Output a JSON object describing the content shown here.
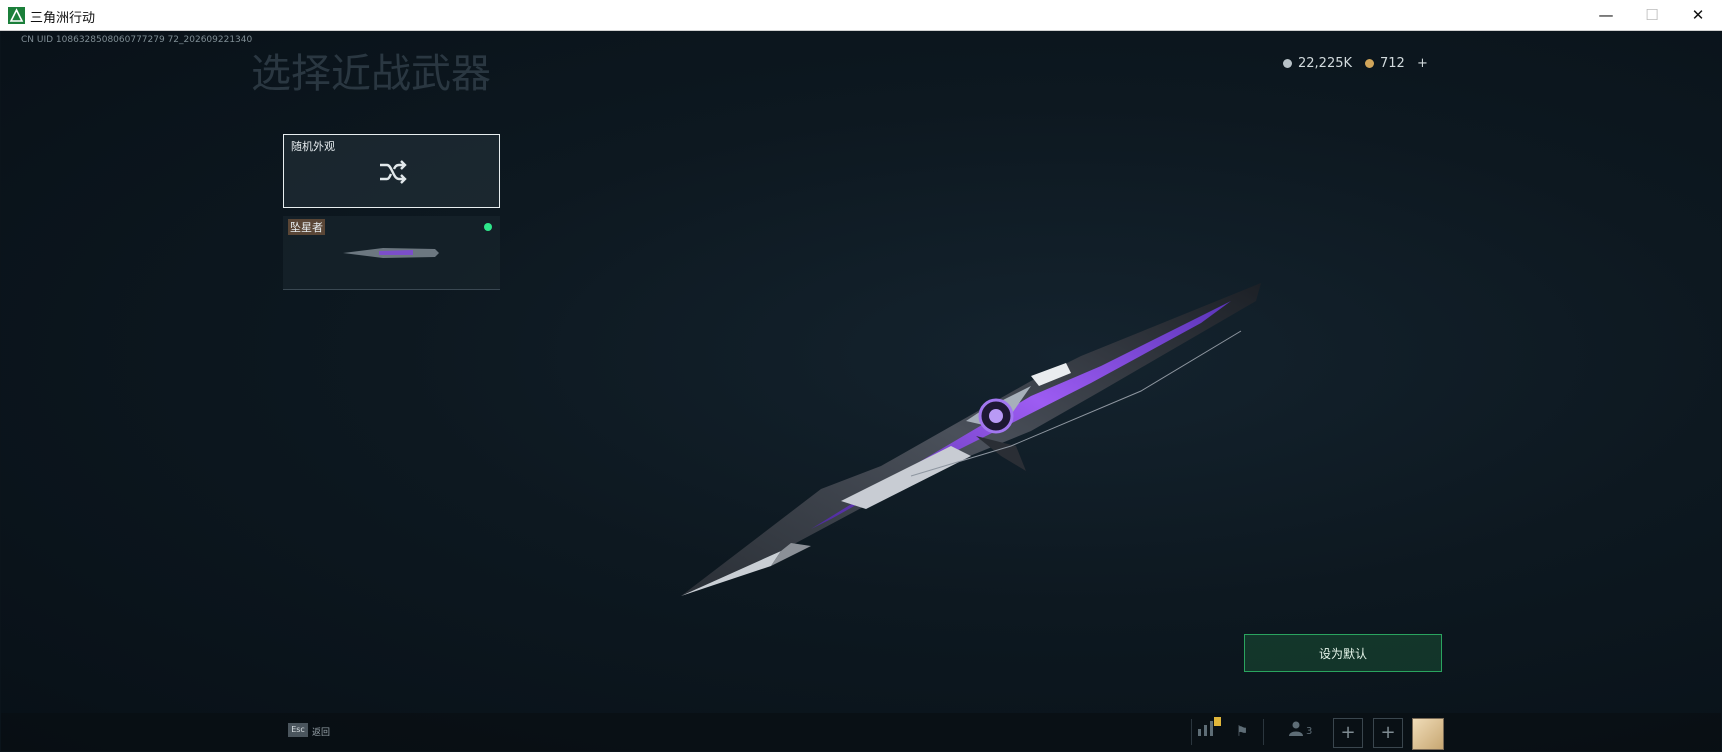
{
  "window": {
    "title": "三角洲行动",
    "minimize": "—",
    "maximize": "☐",
    "close": "✕"
  },
  "hud": {
    "uid": "CN UID 1086328508060777279 72_202609221340",
    "page_title": "选择近战武器",
    "currency_a": "22,225K",
    "currency_b": "712",
    "currency_add": "+"
  },
  "cards": [
    {
      "label": "随机外观",
      "icon": "shuffle-icon"
    },
    {
      "label": "坠星者",
      "tag": true,
      "equipped": true
    }
  ],
  "actions": {
    "set_default": "设为默认"
  },
  "bottom": {
    "esc_key": "Esc",
    "esc_label": "返回",
    "friends_count": "3",
    "plus": "+"
  },
  "colors": {
    "accent_green": "#2ee68a",
    "blade_purple": "#8a48e0"
  }
}
